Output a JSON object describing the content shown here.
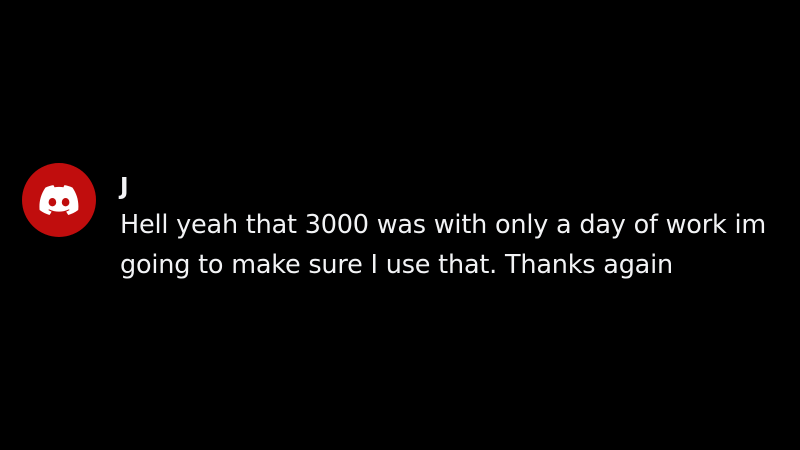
{
  "colors": {
    "background": "#000000",
    "avatar_bg": "#c00d0d",
    "text": "#f2f3f5"
  },
  "message": {
    "avatar_icon": "discord-logo-icon",
    "username": "J",
    "text": "Hell yeah that 3000 was with only a day of work im going to make sure I use that. Thanks again"
  }
}
